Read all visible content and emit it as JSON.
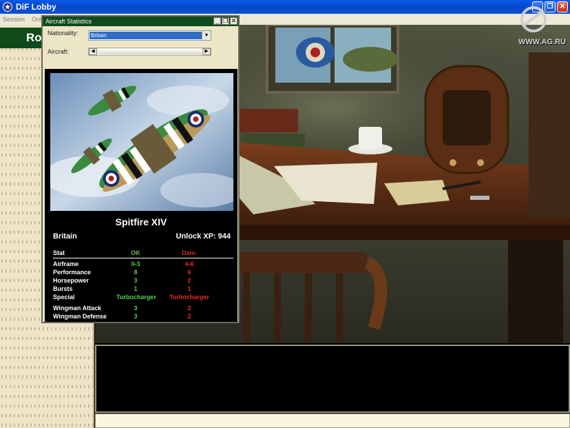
{
  "window": {
    "title": "DiF Lobby"
  },
  "menu": {
    "items": [
      "Session",
      "Onl"
    ]
  },
  "left_panel": {
    "header": "Ro"
  },
  "watermark": "WWW.AG.RU",
  "dialog": {
    "title": "Aircraft Statistics",
    "nationality_label": "Nationality:",
    "nationality_value": "Britain",
    "aircraft_label": "Aircraft:",
    "aircraft_name": "Spitfire XIV",
    "nation": "Britain",
    "unlock": "Unlock XP: 944",
    "columns": {
      "stat": "Stat",
      "ok": "OK",
      "dam": "Dam."
    },
    "rows": [
      {
        "stat": "Airframe",
        "ok": "0-3",
        "dam": "4-6"
      },
      {
        "stat": "Performance",
        "ok": "8",
        "dam": "6"
      },
      {
        "stat": "Horsepower",
        "ok": "3",
        "dam": "2"
      },
      {
        "stat": "Bursts",
        "ok": "1",
        "dam": "1"
      },
      {
        "stat": "Special",
        "ok": "Turbocharger",
        "dam": "Turbocharger"
      },
      {
        "stat": "Wingman Attack",
        "ok": "3",
        "dam": "2"
      },
      {
        "stat": "Wingman Defense",
        "ok": "3",
        "dam": "2"
      }
    ]
  },
  "colors": {
    "ok": "#4ed04a",
    "dam": "#e82a20",
    "panel_green": "#0e4a1e"
  }
}
